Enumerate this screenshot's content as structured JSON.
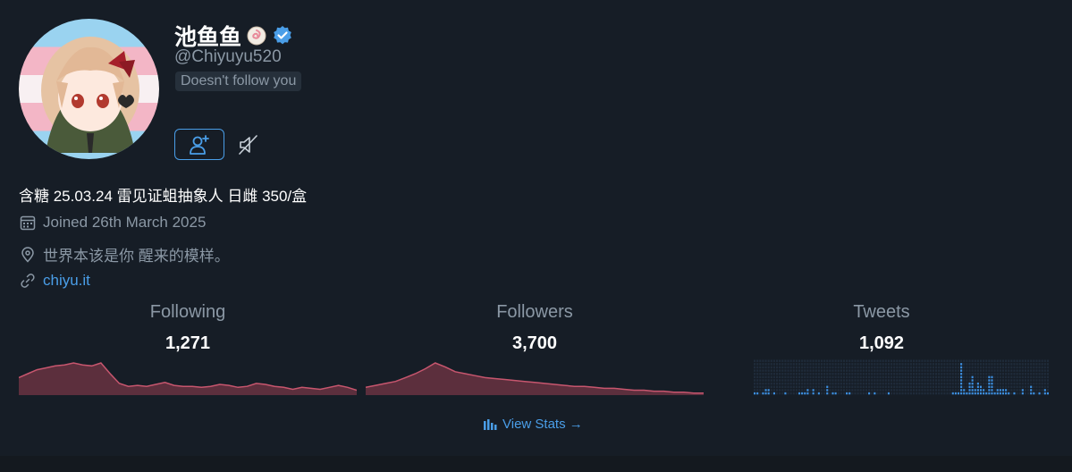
{
  "profile": {
    "display_name": "池鱼鱼",
    "handle": "@Chiyuyu520",
    "follow_status": "Doesn't follow you",
    "bio": "含糖 25.03.24 雷见证蛆抽象人 日雌 350/盒",
    "joined": "Joined 26th March 2025",
    "location": "世界本该是你 醒来的模样。",
    "website": "chiyu.it"
  },
  "stats": [
    {
      "label": "Following",
      "value": "1,271"
    },
    {
      "label": "Followers",
      "value": "3,700"
    },
    {
      "label": "Tweets",
      "value": "1,092"
    }
  ],
  "actions": {
    "view_stats": "View Stats →"
  },
  "colors": {
    "background": "#161d26",
    "accent": "#4a9ee8",
    "sparkline_fill": "#5c2f3d",
    "sparkline_stroke": "#c7566e",
    "muted_text": "#8b98a5"
  },
  "chart_data": [
    {
      "type": "area",
      "name": "Following trend",
      "values": [
        18,
        22,
        26,
        28,
        30,
        31,
        33,
        31,
        30,
        33,
        22,
        12,
        9,
        10,
        9,
        11,
        13,
        10,
        9,
        9,
        8,
        9,
        11,
        10,
        8,
        9,
        12,
        11,
        9,
        8,
        6,
        8,
        7,
        6,
        8,
        10,
        8,
        5
      ]
    },
    {
      "type": "area",
      "name": "Followers trend",
      "values": [
        8,
        10,
        12,
        14,
        18,
        22,
        27,
        33,
        29,
        24,
        22,
        20,
        18,
        17,
        16,
        15,
        14,
        13,
        12,
        11,
        10,
        9,
        9,
        8,
        7,
        7,
        6,
        5,
        5,
        4,
        4,
        3,
        3,
        2,
        2
      ]
    },
    {
      "type": "bar",
      "name": "Tweets activity",
      "values": [
        1,
        1,
        0,
        1,
        2,
        2,
        0,
        1,
        0,
        0,
        0,
        1,
        0,
        0,
        0,
        0,
        1,
        1,
        1,
        2,
        0,
        2,
        0,
        1,
        0,
        0,
        3,
        0,
        1,
        1,
        0,
        0,
        0,
        1,
        1,
        0,
        0,
        0,
        0,
        0,
        0,
        1,
        0,
        1,
        0,
        0,
        0,
        0,
        1,
        0,
        0,
        0,
        0,
        0,
        0,
        0,
        0,
        0,
        0,
        0,
        0,
        0,
        0,
        0,
        0,
        0,
        0,
        0,
        0,
        0,
        0,
        1,
        1,
        1,
        10,
        2,
        1,
        4,
        6,
        2,
        4,
        3,
        2,
        1,
        6,
        6,
        1,
        2,
        2,
        2,
        2,
        1,
        0,
        1,
        0,
        0,
        2,
        0,
        0,
        3,
        1,
        0,
        1,
        0,
        2,
        1
      ]
    }
  ]
}
